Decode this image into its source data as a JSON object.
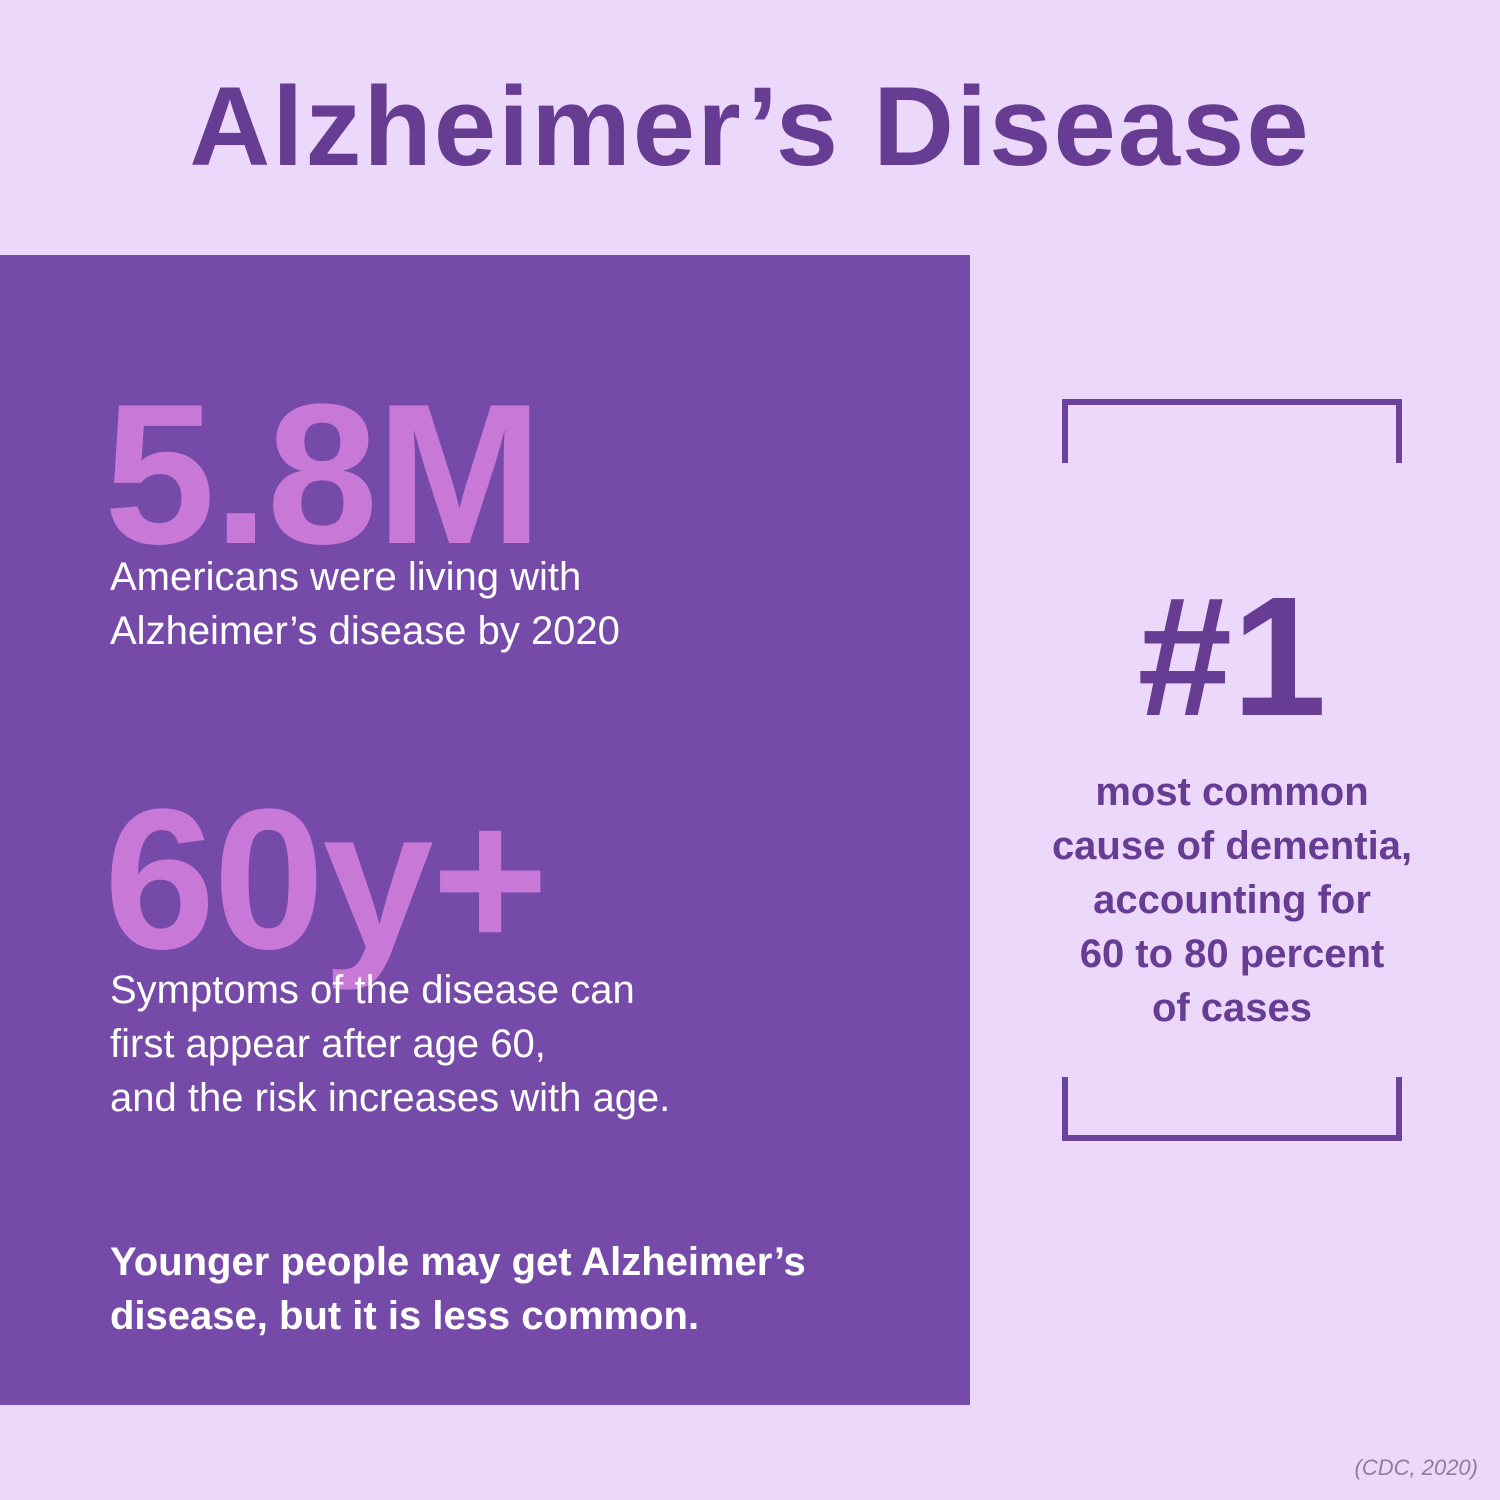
{
  "title": "Alzheimer’s Disease",
  "stats": [
    {
      "value": "5.8M",
      "description": "Americans were living with\nAlzheimer’s disease by 2020"
    },
    {
      "value": "60y+",
      "description": "Symptoms of the disease can\nfirst appear after age 60,\nand the risk increases with age."
    }
  ],
  "note": "Younger people may get Alzheimer’s\ndisease, but it is less common.",
  "highlight": {
    "value": "#1",
    "description": "most common\ncause of dementia,\naccounting for\n60 to 80 percent\nof cases"
  },
  "source": "(CDC, 2020)",
  "colors": {
    "background": "#ecd8fb",
    "panel": "#754aa9",
    "title": "#673c93",
    "stat_accent": "#c879d8",
    "panel_text": "#ffffff"
  }
}
